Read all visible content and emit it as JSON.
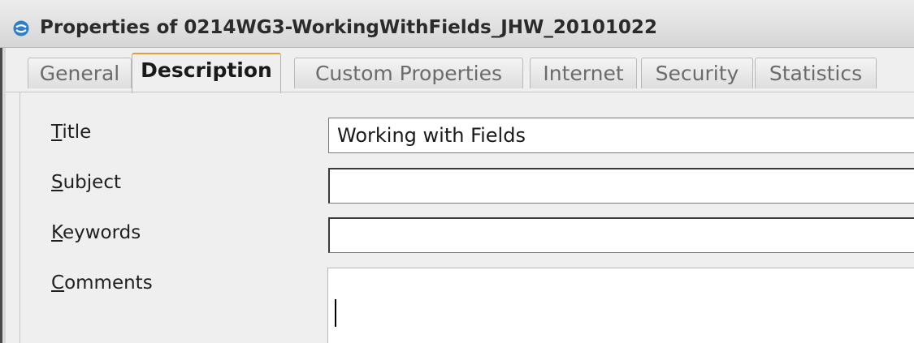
{
  "window": {
    "title": "Properties of 0214WG3-WorkingWithFields_JHW_20101022",
    "icon": "libreoffice-icon"
  },
  "tabs": [
    {
      "label": "General",
      "active": false
    },
    {
      "label": "Description",
      "active": true
    },
    {
      "label": "Custom Properties",
      "active": false
    },
    {
      "label": "Internet",
      "active": false
    },
    {
      "label": "Security",
      "active": false
    },
    {
      "label": "Statistics",
      "active": false
    }
  ],
  "form": {
    "title": {
      "mnemonic": "T",
      "rest": "itle",
      "value": "Working with Fields"
    },
    "subject": {
      "mnemonic": "S",
      "rest": "ubject",
      "value": ""
    },
    "keywords": {
      "mnemonic": "K",
      "rest": "eywords",
      "value": ""
    },
    "comments": {
      "mnemonic": "C",
      "rest": "omments",
      "value": ""
    }
  },
  "colors": {
    "active_tab_accent": "#d9a232",
    "title_icon": "#2f7fc6"
  }
}
